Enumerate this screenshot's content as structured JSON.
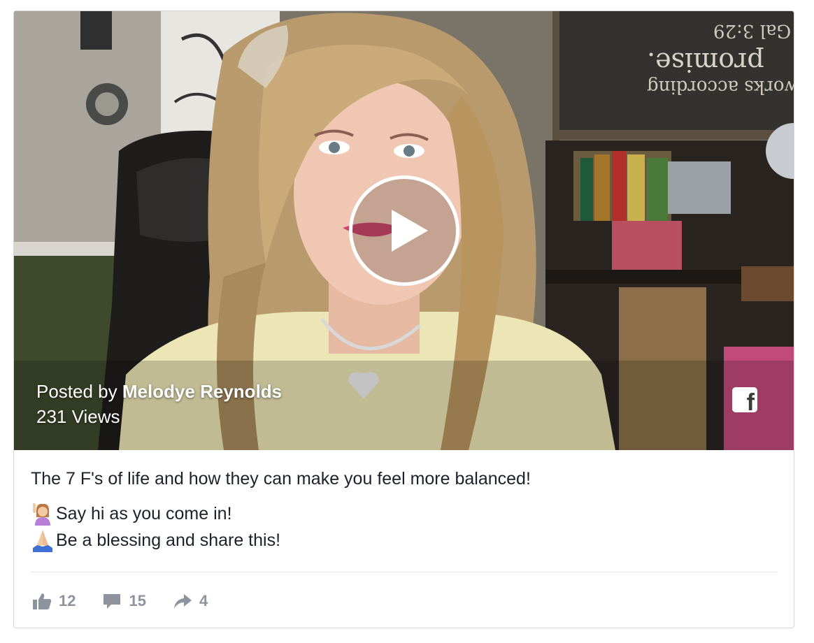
{
  "video": {
    "posted_by_prefix": "Posted by ",
    "author": "Melodye Reynolds",
    "views": "231 Views",
    "chalkboard_lines": [
      "works according",
      "promise.",
      "- Gal 3:29"
    ]
  },
  "post": {
    "title": "The 7 F's of life and how they can make you feel more balanced!",
    "lines": [
      {
        "emoji": "raising-hand-emoji",
        "text": "Say hi as you come in!"
      },
      {
        "emoji": "folded-hands-emoji",
        "text": "Be a blessing and share this!"
      }
    ]
  },
  "actions": {
    "likes": "12",
    "comments": "15",
    "shares": "4"
  },
  "colors": {
    "text_primary": "#1d2129",
    "action_gray": "#8d949e",
    "border": "#d5d7db"
  },
  "icons": [
    "play-icon",
    "facebook-icon",
    "like-icon",
    "comment-icon",
    "share-icon"
  ]
}
